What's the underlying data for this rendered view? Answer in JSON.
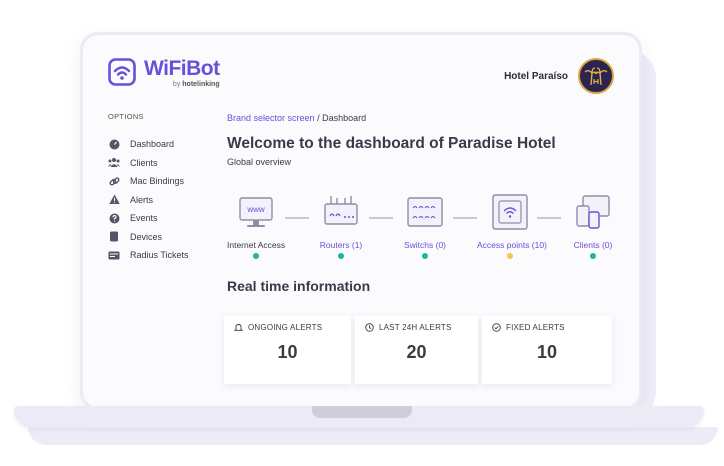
{
  "brand": {
    "name": "WiFiBot",
    "by_label": "by",
    "by_company": "hotelinking"
  },
  "header": {
    "hotel_name": "Hotel Paraíso"
  },
  "sidebar": {
    "title": "OPTIONS",
    "items": [
      {
        "label": "Dashboard",
        "icon": "dashboard-icon"
      },
      {
        "label": "Clients",
        "icon": "users-icon"
      },
      {
        "label": "Mac Bindings",
        "icon": "link-icon"
      },
      {
        "label": "Alerts",
        "icon": "warning-icon"
      },
      {
        "label": "Events",
        "icon": "question-icon"
      },
      {
        "label": "Devices",
        "icon": "device-icon"
      },
      {
        "label": "Radius Tickets",
        "icon": "ticket-icon"
      }
    ]
  },
  "breadcrumb": {
    "parent": "Brand selector screen",
    "separator": "/",
    "current": "Dashboard"
  },
  "main": {
    "title": "Welcome to the dashboard of Paradise Hotel",
    "subtitle": "Global overview"
  },
  "topology": {
    "nodes": [
      {
        "label": "Internet Access",
        "status": "ok"
      },
      {
        "label": "Routers (1)",
        "status": "ok"
      },
      {
        "label": "Switchs (0)",
        "status": "ok"
      },
      {
        "label": "Access points (10)",
        "status": "warning"
      },
      {
        "label": "Clients (0)",
        "status": "ok"
      }
    ],
    "icons": {
      "internet_text": "www"
    }
  },
  "realtime": {
    "title": "Real time information",
    "cards": [
      {
        "label": "ONGOING ALERTS",
        "value": "10"
      },
      {
        "label": "LAST 24H ALERTS",
        "value": "20"
      },
      {
        "label": "FIXED ALERTS",
        "value": "10"
      }
    ]
  },
  "colors": {
    "accent": "#6a4fd8",
    "ok": "#1fb5a0",
    "warning": "#f1c84b",
    "text": "#3a3a48"
  }
}
